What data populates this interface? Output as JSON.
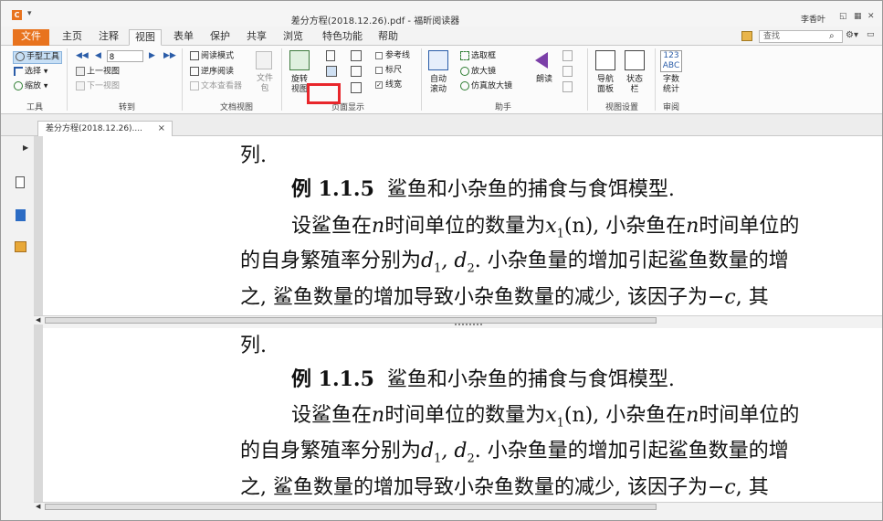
{
  "window": {
    "title": "差分方程(2018.12.26).pdf - 福昕阅读器",
    "user": "李香叶",
    "app_icon_text": "C",
    "qa_icon": "dropdown-icon"
  },
  "menu": {
    "tabs": [
      "文件",
      "主页",
      "注释",
      "视图",
      "表单",
      "保护",
      "共享",
      "浏览",
      "特色功能",
      "帮助"
    ],
    "active": "视图"
  },
  "search": {
    "placeholder": "查找"
  },
  "ribbon": {
    "tools": {
      "hand": "手型工具",
      "select": "选择",
      "zoom": "缩放",
      "label": "工具"
    },
    "goto": {
      "page": "8",
      "prev_view": "上一视图",
      "next_view": "下一视图",
      "label": "转到"
    },
    "docview": {
      "read_mode": "阅读模式",
      "reverse": "逆序阅读",
      "text_viewer": "文本查看器",
      "file_pkg": "文件包",
      "label": "文档视图"
    },
    "pagedisplay": {
      "rotate": "旋转视图",
      "guides": "参考线",
      "ruler": "标尺",
      "linewidth": "线宽",
      "label": "页面显示"
    },
    "assistant": {
      "auto_scroll": "自动滚动",
      "marquee": "选取框",
      "magnifier": "放大镜",
      "loupe": "仿真放大镜",
      "read_aloud": "朗读",
      "label": "助手"
    },
    "viewsettings": {
      "nav_panel": "导航面板",
      "status_bar": "状态栏",
      "label": "视图设置"
    },
    "review": {
      "word_count": "字数统计",
      "wc_icon": "123 ABC",
      "label": "审阅"
    }
  },
  "doc_tab": {
    "title": "差分方程(2018.12.26)....",
    "close": "×"
  },
  "document": {
    "line0": "列.",
    "example_num": "例 1.1.5",
    "example_title": "鲨鱼和小杂鱼的捕食与食饵模型.",
    "p1a": "设鲨鱼在",
    "p1n": "n",
    "p1b": "时间单位的数量为",
    "p1x": "x",
    "p1sub": "1",
    "p1c": "(n), 小杂鱼在",
    "p1n2": "n",
    "p1d": "时间单位的",
    "p2a": "的自身繁殖率分别为",
    "p2d1": "d",
    "p2s1": "1",
    "p2d2": ", d",
    "p2s2": "2",
    "p2b": ". 小杂鱼量的增加引起鲨鱼数量的增",
    "p3a": "之, 鲨鱼数量的增加导致小杂鱼数量的减少, 该因子为",
    "p3c": "−c",
    "p3b": ", 其"
  }
}
